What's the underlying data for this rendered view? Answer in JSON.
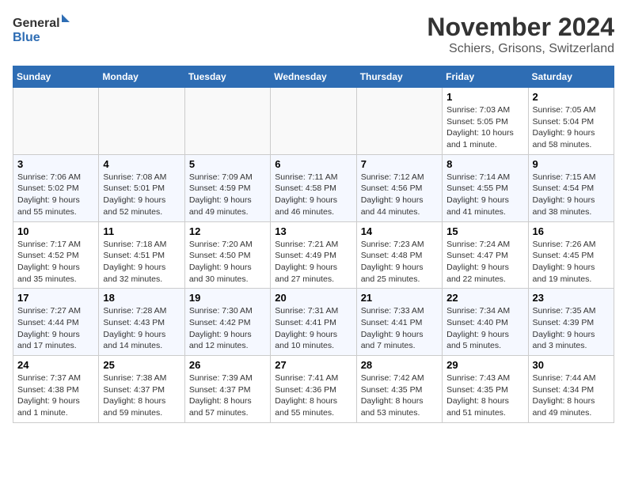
{
  "logo": {
    "line1": "General",
    "line2": "Blue"
  },
  "title": "November 2024",
  "location": "Schiers, Grisons, Switzerland",
  "days_of_week": [
    "Sunday",
    "Monday",
    "Tuesday",
    "Wednesday",
    "Thursday",
    "Friday",
    "Saturday"
  ],
  "weeks": [
    [
      {
        "day": "",
        "info": ""
      },
      {
        "day": "",
        "info": ""
      },
      {
        "day": "",
        "info": ""
      },
      {
        "day": "",
        "info": ""
      },
      {
        "day": "",
        "info": ""
      },
      {
        "day": "1",
        "info": "Sunrise: 7:03 AM\nSunset: 5:05 PM\nDaylight: 10 hours and 1 minute."
      },
      {
        "day": "2",
        "info": "Sunrise: 7:05 AM\nSunset: 5:04 PM\nDaylight: 9 hours and 58 minutes."
      }
    ],
    [
      {
        "day": "3",
        "info": "Sunrise: 7:06 AM\nSunset: 5:02 PM\nDaylight: 9 hours and 55 minutes."
      },
      {
        "day": "4",
        "info": "Sunrise: 7:08 AM\nSunset: 5:01 PM\nDaylight: 9 hours and 52 minutes."
      },
      {
        "day": "5",
        "info": "Sunrise: 7:09 AM\nSunset: 4:59 PM\nDaylight: 9 hours and 49 minutes."
      },
      {
        "day": "6",
        "info": "Sunrise: 7:11 AM\nSunset: 4:58 PM\nDaylight: 9 hours and 46 minutes."
      },
      {
        "day": "7",
        "info": "Sunrise: 7:12 AM\nSunset: 4:56 PM\nDaylight: 9 hours and 44 minutes."
      },
      {
        "day": "8",
        "info": "Sunrise: 7:14 AM\nSunset: 4:55 PM\nDaylight: 9 hours and 41 minutes."
      },
      {
        "day": "9",
        "info": "Sunrise: 7:15 AM\nSunset: 4:54 PM\nDaylight: 9 hours and 38 minutes."
      }
    ],
    [
      {
        "day": "10",
        "info": "Sunrise: 7:17 AM\nSunset: 4:52 PM\nDaylight: 9 hours and 35 minutes."
      },
      {
        "day": "11",
        "info": "Sunrise: 7:18 AM\nSunset: 4:51 PM\nDaylight: 9 hours and 32 minutes."
      },
      {
        "day": "12",
        "info": "Sunrise: 7:20 AM\nSunset: 4:50 PM\nDaylight: 9 hours and 30 minutes."
      },
      {
        "day": "13",
        "info": "Sunrise: 7:21 AM\nSunset: 4:49 PM\nDaylight: 9 hours and 27 minutes."
      },
      {
        "day": "14",
        "info": "Sunrise: 7:23 AM\nSunset: 4:48 PM\nDaylight: 9 hours and 25 minutes."
      },
      {
        "day": "15",
        "info": "Sunrise: 7:24 AM\nSunset: 4:47 PM\nDaylight: 9 hours and 22 minutes."
      },
      {
        "day": "16",
        "info": "Sunrise: 7:26 AM\nSunset: 4:45 PM\nDaylight: 9 hours and 19 minutes."
      }
    ],
    [
      {
        "day": "17",
        "info": "Sunrise: 7:27 AM\nSunset: 4:44 PM\nDaylight: 9 hours and 17 minutes."
      },
      {
        "day": "18",
        "info": "Sunrise: 7:28 AM\nSunset: 4:43 PM\nDaylight: 9 hours and 14 minutes."
      },
      {
        "day": "19",
        "info": "Sunrise: 7:30 AM\nSunset: 4:42 PM\nDaylight: 9 hours and 12 minutes."
      },
      {
        "day": "20",
        "info": "Sunrise: 7:31 AM\nSunset: 4:41 PM\nDaylight: 9 hours and 10 minutes."
      },
      {
        "day": "21",
        "info": "Sunrise: 7:33 AM\nSunset: 4:41 PM\nDaylight: 9 hours and 7 minutes."
      },
      {
        "day": "22",
        "info": "Sunrise: 7:34 AM\nSunset: 4:40 PM\nDaylight: 9 hours and 5 minutes."
      },
      {
        "day": "23",
        "info": "Sunrise: 7:35 AM\nSunset: 4:39 PM\nDaylight: 9 hours and 3 minutes."
      }
    ],
    [
      {
        "day": "24",
        "info": "Sunrise: 7:37 AM\nSunset: 4:38 PM\nDaylight: 9 hours and 1 minute."
      },
      {
        "day": "25",
        "info": "Sunrise: 7:38 AM\nSunset: 4:37 PM\nDaylight: 8 hours and 59 minutes."
      },
      {
        "day": "26",
        "info": "Sunrise: 7:39 AM\nSunset: 4:37 PM\nDaylight: 8 hours and 57 minutes."
      },
      {
        "day": "27",
        "info": "Sunrise: 7:41 AM\nSunset: 4:36 PM\nDaylight: 8 hours and 55 minutes."
      },
      {
        "day": "28",
        "info": "Sunrise: 7:42 AM\nSunset: 4:35 PM\nDaylight: 8 hours and 53 minutes."
      },
      {
        "day": "29",
        "info": "Sunrise: 7:43 AM\nSunset: 4:35 PM\nDaylight: 8 hours and 51 minutes."
      },
      {
        "day": "30",
        "info": "Sunrise: 7:44 AM\nSunset: 4:34 PM\nDaylight: 8 hours and 49 minutes."
      }
    ]
  ]
}
